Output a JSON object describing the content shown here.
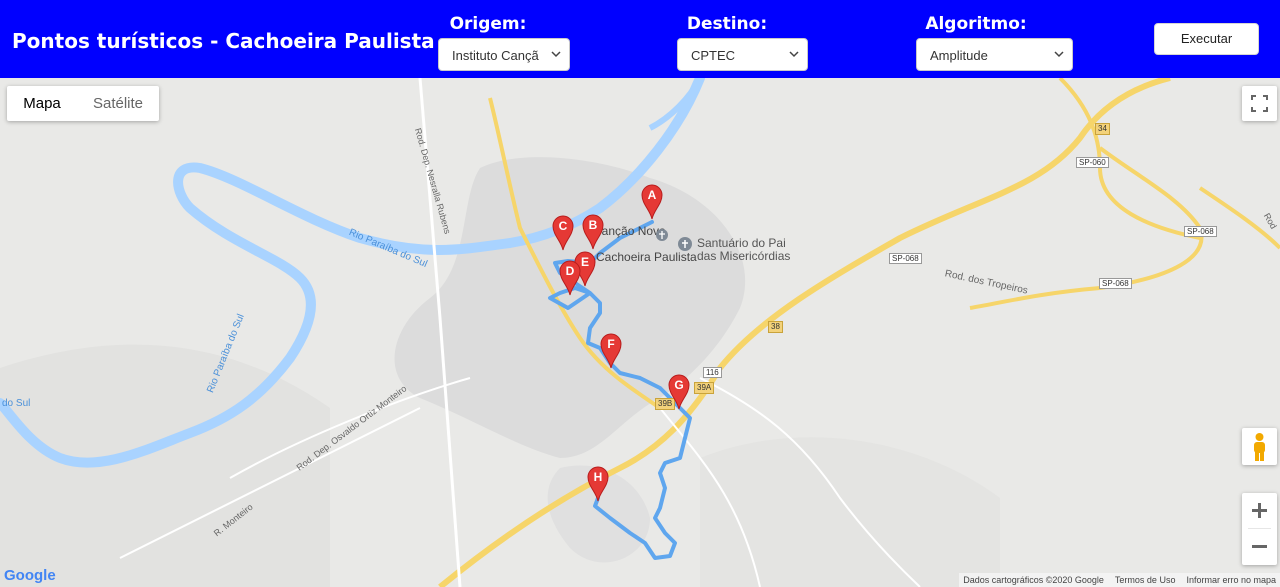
{
  "header": {
    "title": "Pontos turísticos - Cachoeira Paulista",
    "origin_label": "Origem:",
    "origin_value": "Instituto Cançã",
    "destination_label": "Destino:",
    "destination_value": "CPTEC",
    "algorithm_label": "Algoritmo:",
    "algorithm_value": "Amplitude",
    "run_label": "Executar"
  },
  "map": {
    "type_map": "Mapa",
    "type_satellite": "Satélite",
    "place_1": "Canção Nova",
    "place_2a": "Santuário do Pai",
    "place_2b": "das Misericórdias",
    "town": "Cachoeira Paulista",
    "rivers": [
      "Rio Paraíba do Sul",
      "Rio Paraíba do Sul",
      "do Sul"
    ],
    "roads": [
      "Rod. Dep. Nesralla Rubens",
      "Rod. Dep. Osvaldo Ortiz Monteiro",
      "R. Monteiro",
      "Rod. dos Tropeiros",
      "Rod"
    ],
    "shields": [
      "SP-060",
      "SP-068",
      "SP-068",
      "SP-068",
      "34",
      "38",
      "116",
      "39A",
      "39B"
    ],
    "markers": [
      "A",
      "B",
      "C",
      "D",
      "E",
      "F",
      "G",
      "H"
    ],
    "logo": "Google",
    "footer": [
      "Dados cartográficos ©2020 Google",
      "Termos de Uso",
      "Informar erro no mapa"
    ],
    "route_color": "#5fa6ee",
    "marker_color": "#e53935"
  }
}
